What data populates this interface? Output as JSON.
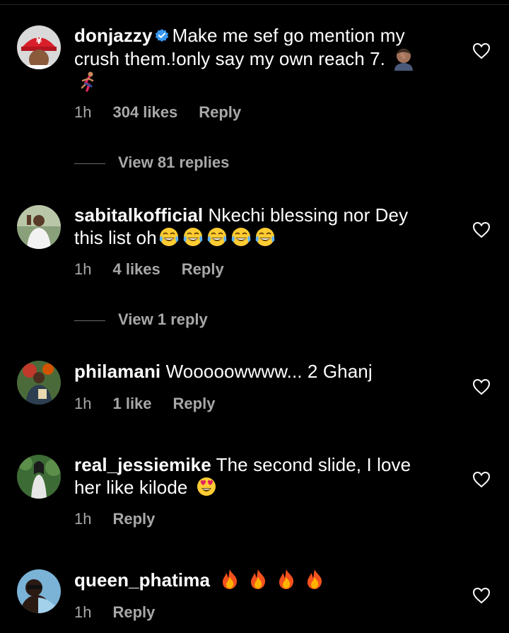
{
  "comments": [
    {
      "username": "donjazzy",
      "verified": true,
      "text_line1": "Make me sef go mention my",
      "text_line2": "crush them.!only say my own reach 7.",
      "time": "1h",
      "likes": "304 likes",
      "reply": "Reply",
      "view_replies": "View 81 replies",
      "emojis": [
        "facepalm-emoji",
        "runner-emoji"
      ]
    },
    {
      "username": "sabitalkofficial",
      "text_line1": "Nkechi blessing nor Dey",
      "text_line2": "this list oh",
      "time": "1h",
      "likes": "4 likes",
      "reply": "Reply",
      "view_replies": "View 1 reply",
      "emojis": [
        "tears-of-joy-emoji",
        "tears-of-joy-emoji",
        "tears-of-joy-emoji",
        "tears-of-joy-emoji",
        "tears-of-joy-emoji"
      ]
    },
    {
      "username": "philamani",
      "text_line1": "Wooooowwww... 2 Ghanj",
      "time": "1h",
      "likes": "1 like",
      "reply": "Reply"
    },
    {
      "username": "real_jessiemike",
      "text_line1": "The second slide, I love",
      "text_line2": "her like kilode",
      "time": "1h",
      "reply": "Reply",
      "emojis": [
        "heart-eyes-emoji"
      ]
    },
    {
      "username": "queen_phatima",
      "time": "1h",
      "reply": "Reply",
      "emojis": [
        "fire-emoji",
        "fire-emoji",
        "fire-emoji",
        "fire-emoji"
      ]
    }
  ],
  "colors": {
    "background": "#000000",
    "text": "#ffffff",
    "secondary_text": "#a8a8a8",
    "verified_badge": "#3897f0"
  }
}
